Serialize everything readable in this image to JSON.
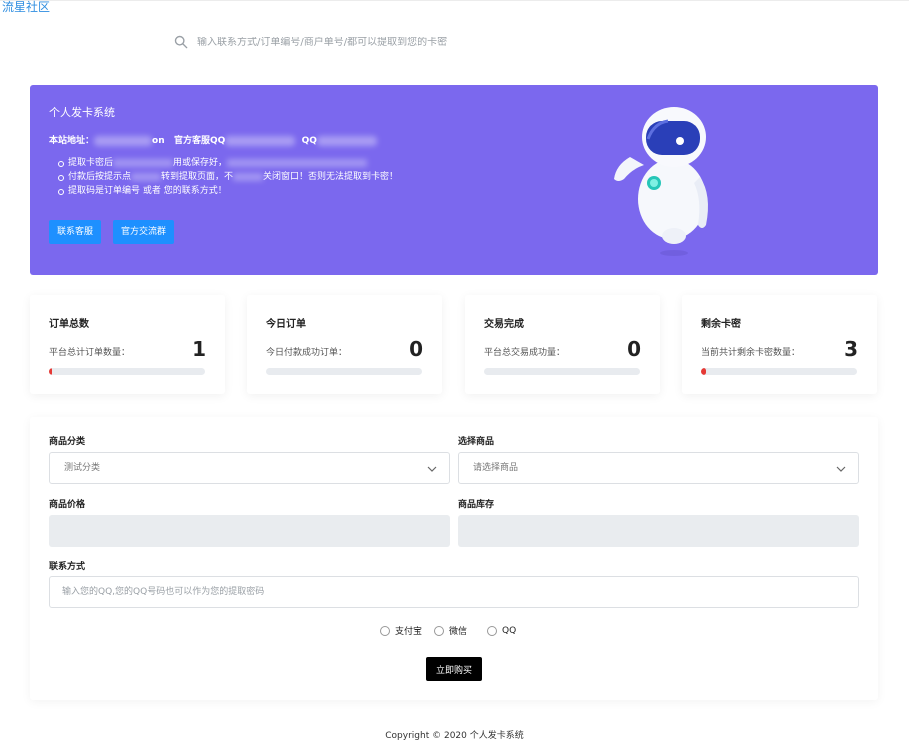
{
  "header": {
    "brand": "流星社区",
    "search_placeholder": "输入联系方式/订单编号/商户单号/都可以提取到您的卡密"
  },
  "banner": {
    "title": "个人发卡系统",
    "addr_label": "本站地址：",
    "addr_domain_tail": "on",
    "service_label": "官方客服QQ",
    "qq_label": "QQ",
    "notes": [
      "提取卡密后",
      "付款后按提示点",
      "提取码是订单编号 或者 您的联系方式！"
    ],
    "note_fragments": {
      "note1_tail": "用或保存好，",
      "note2_tail": "转到提取页面，不",
      "note2_end": "关闭窗口！否则无法提取到卡密！"
    },
    "buttons": {
      "contact": "联系客服",
      "group": "官方交流群"
    }
  },
  "stats": [
    {
      "label": "订单总数",
      "sub": "平台总计订单数量：",
      "value": "1",
      "progress": 0.02
    },
    {
      "label": "今日订单",
      "sub": "今日付款成功订单：",
      "value": "0",
      "progress": 0
    },
    {
      "label": "交易完成",
      "sub": "平台总交易成功量：",
      "value": "0",
      "progress": 0
    },
    {
      "label": "剩余卡密",
      "sub": "当前共计剩余卡密数量：",
      "value": "3",
      "progress": 0.03
    }
  ],
  "form": {
    "category_label": "商品分类",
    "category_value": "测试分类",
    "product_label": "选择商品",
    "product_value": "请选择商品",
    "price_label": "商品价格",
    "stock_label": "商品库存",
    "contact_label": "联系方式",
    "contact_placeholder": "输入您的QQ,您的QQ号码也可以作为您的提取密码",
    "payments": [
      "支付宝",
      "微信",
      "QQ"
    ],
    "buy_label": "立即购买"
  },
  "footer": {
    "copyright": "Copyright © 2020 个人发卡系统"
  },
  "colors": {
    "banner": "#7b68ee",
    "button": "#1e90ff",
    "buy": "#000000",
    "progress": "#e53935"
  }
}
